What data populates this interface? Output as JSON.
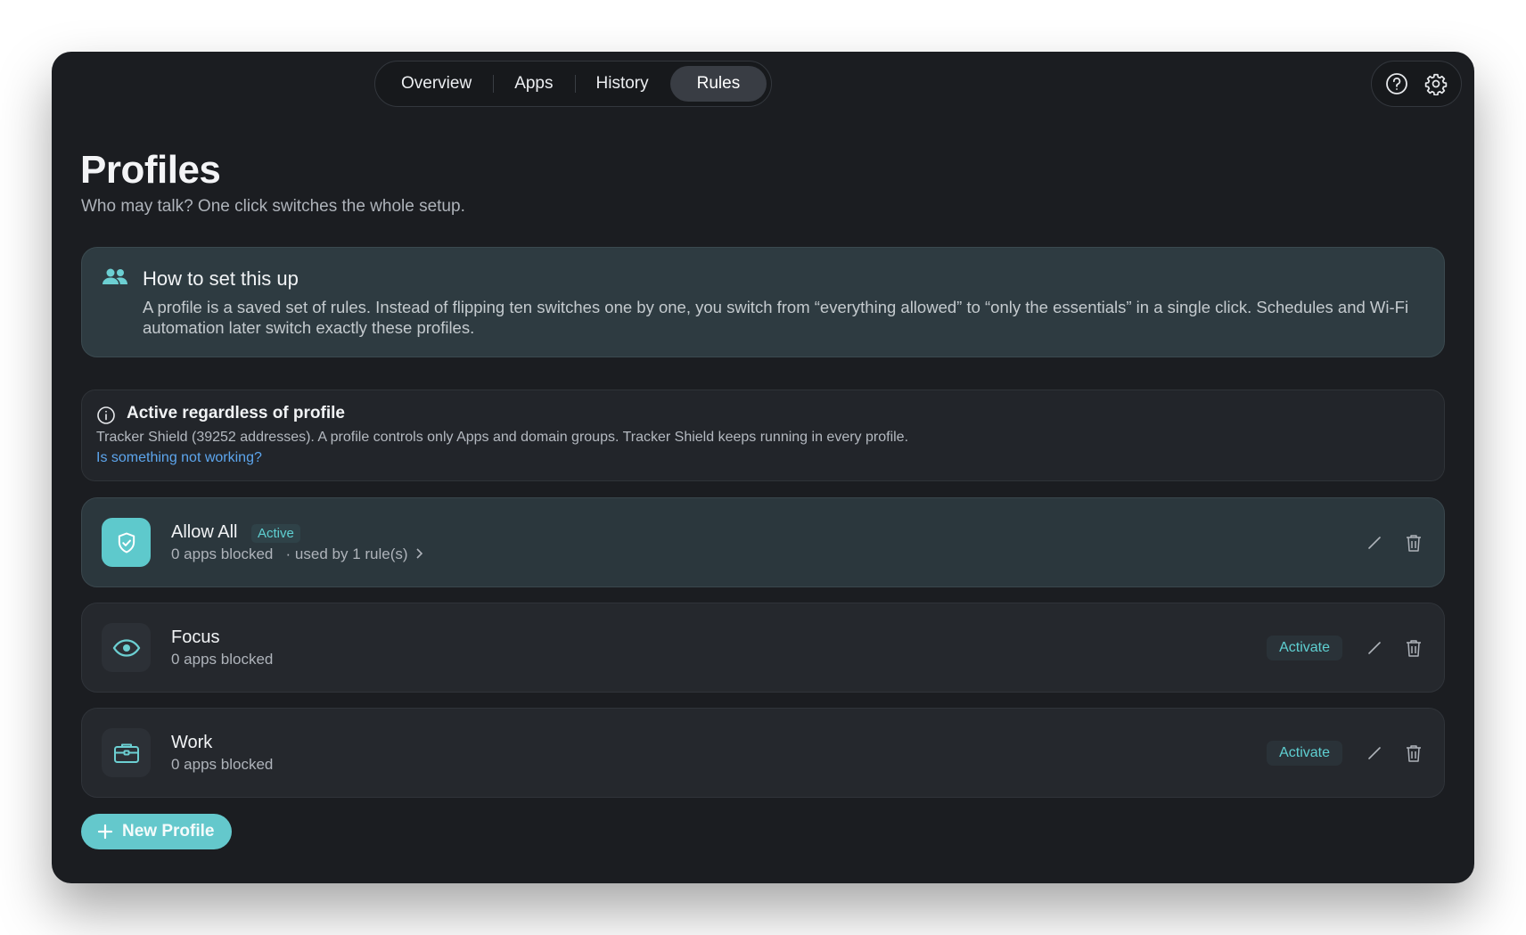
{
  "nav": {
    "tabs": [
      {
        "label": "Overview",
        "active": false
      },
      {
        "label": "Apps",
        "active": false
      },
      {
        "label": "History",
        "active": false
      },
      {
        "label": "Rules",
        "active": true
      }
    ],
    "help_icon": "help-circle-icon",
    "settings_icon": "gear-icon"
  },
  "page": {
    "title": "Profiles",
    "subtitle": "Who may talk? One click switches the whole setup."
  },
  "info": {
    "icon": "people-icon",
    "title": "How to set this up",
    "body": "A profile is a saved set of rules. Instead of flipping ten switches one by one, you switch from “everything allowed” to “only the essentials” in a single click. Schedules and Wi-Fi automation later switch exactly these profiles."
  },
  "note": {
    "icon": "info-icon",
    "title": "Active regardless of profile",
    "body": "Tracker Shield (39252 addresses). A profile controls only Apps and domain groups. Tracker Shield keeps running in every profile.",
    "link": "Is something not working?"
  },
  "profiles": [
    {
      "name": "Allow All",
      "icon": "shield-check-icon",
      "badge": "Active",
      "blocked": "0 apps blocked",
      "rules_link": "· used by 1 rule(s)",
      "active": true
    },
    {
      "name": "Focus",
      "icon": "eye-icon",
      "blocked": "0 apps blocked",
      "activate_label": "Activate",
      "active": false
    },
    {
      "name": "Work",
      "icon": "briefcase-icon",
      "blocked": "0 apps blocked",
      "activate_label": "Activate",
      "active": false
    }
  ],
  "actions": {
    "new_profile": "New Profile"
  },
  "colors": {
    "accent": "#5ec9cc",
    "link": "#5da6ee",
    "background": "#1b1d21"
  }
}
